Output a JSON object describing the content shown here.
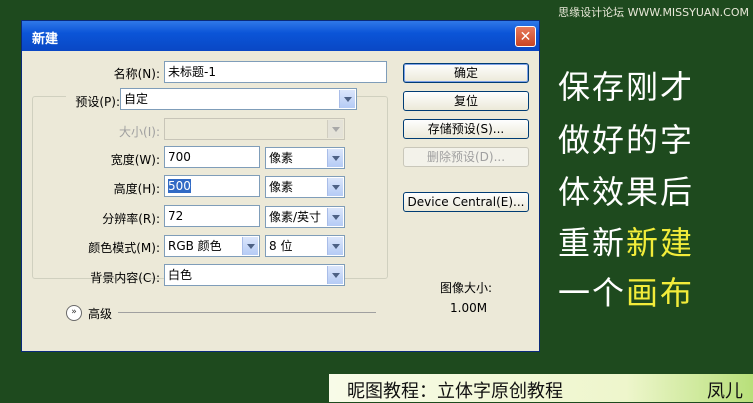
{
  "watermark": "思缘设计论坛 WWW.MISSYUAN.COM",
  "dialog": {
    "title": "新建",
    "name_label": "名称(N):",
    "name_value": "未标题-1",
    "preset_label": "预设(P):",
    "preset_value": "自定",
    "size_label": "大小(I):",
    "width_label": "宽度(W):",
    "width_value": "700",
    "width_unit": "像素",
    "height_label": "高度(H):",
    "height_value": "500",
    "height_unit": "像素",
    "resolution_label": "分辨率(R):",
    "resolution_value": "72",
    "resolution_unit": "像素/英寸",
    "color_mode_label": "颜色模式(M):",
    "color_mode_value": "RGB 颜色",
    "bit_depth_value": "8 位",
    "background_label": "背景内容(C):",
    "background_value": "白色",
    "advanced_label": "高级",
    "image_size_label": "图像大小:",
    "image_size_value": "1.00M",
    "buttons": {
      "ok": "确定",
      "reset": "复位",
      "save_preset": "存储预设(S)...",
      "delete_preset": "删除预设(D)...",
      "device_central": "Device Central(E)..."
    }
  },
  "caption": {
    "line1": "保存刚才",
    "line2": "做好的字",
    "line3": "体效果后",
    "line4_a": "重新",
    "line4_b": "新建",
    "line5_a": "一个",
    "line5_b": "画布"
  },
  "footer": {
    "left": "昵图教程：立体字原创教程",
    "right": "凤儿"
  },
  "colors": {
    "background": "#1e4a1e",
    "highlight": "#f2ec3a",
    "title_bar": "#0b55d8"
  }
}
